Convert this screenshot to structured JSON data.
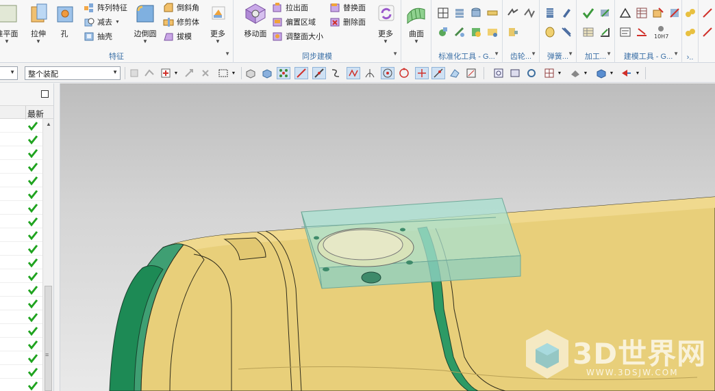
{
  "ribbon": {
    "groups": [
      {
        "label": "特征"
      },
      {
        "label": "同步建模"
      },
      {
        "label": "标准化工具 - G..."
      },
      {
        "label": "齿轮..."
      },
      {
        "label": "弹簧..."
      },
      {
        "label": "加工..."
      },
      {
        "label": "建模工具 - G..."
      },
      {
        "label": "›.."
      }
    ],
    "feature": {
      "datum_plane": "准平面",
      "extrude": "拉伸",
      "hole": "孔",
      "pattern_feature": "阵列特征",
      "subtract": "减去",
      "shell": "抽壳",
      "edge_blend": "边倒圆",
      "chamfer": "倒斜角",
      "trim_body": "修剪体",
      "draft": "拔模",
      "more": "更多"
    },
    "sync": {
      "move_face": "移动面",
      "pull_face": "拉出面",
      "offset_region": "偏置区域",
      "resize_face": "调整面大小",
      "replace_face": "替换面",
      "delete_face": "删除面",
      "more": "更多",
      "surface": "曲面"
    }
  },
  "toolbar": {
    "filter_combo": "",
    "assembly_combo": "整个装配"
  },
  "navigator": {
    "column_new": "最新",
    "rows": 20
  },
  "watermark": {
    "title": "3D世界网",
    "url": "WWW.3DSJW.COM"
  },
  "colors": {
    "body_yellow": "#e8cf7a",
    "face_green": "#1f8a5a",
    "transparent_block": "#a8e0d0",
    "check_green": "#1fa31f",
    "group_label_blue": "#3a6fa6"
  }
}
